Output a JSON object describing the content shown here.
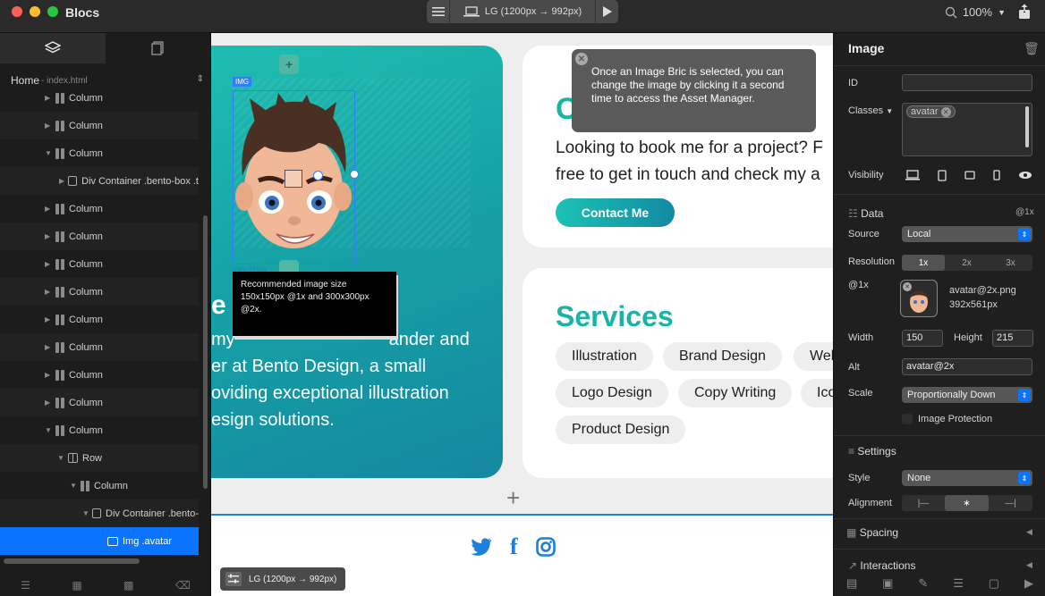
{
  "app": {
    "title": "Blocs",
    "zoom": "100%",
    "breakpoint": "LG (1200px → 992px)"
  },
  "left_panel": {
    "page": "Home",
    "page_file": "- index.html",
    "tree": [
      {
        "label": "Column",
        "type": "column",
        "indent": 50,
        "arrow": "right"
      },
      {
        "label": "Column",
        "type": "column",
        "indent": 50,
        "arrow": "right"
      },
      {
        "label": "Column",
        "type": "column",
        "indent": 50,
        "arrow": "down"
      },
      {
        "label": "Div Container .bento-box .t",
        "type": "box",
        "indent": 66,
        "arrow": "right"
      },
      {
        "label": "Column",
        "type": "column",
        "indent": 50,
        "arrow": "right"
      },
      {
        "label": "Column",
        "type": "column",
        "indent": 50,
        "arrow": "right"
      },
      {
        "label": "Column",
        "type": "column",
        "indent": 50,
        "arrow": "right"
      },
      {
        "label": "Column",
        "type": "column",
        "indent": 50,
        "arrow": "right"
      },
      {
        "label": "Column",
        "type": "column",
        "indent": 50,
        "arrow": "right"
      },
      {
        "label": "Column",
        "type": "column",
        "indent": 50,
        "arrow": "right"
      },
      {
        "label": "Column",
        "type": "column",
        "indent": 50,
        "arrow": "right"
      },
      {
        "label": "Column",
        "type": "column",
        "indent": 50,
        "arrow": "right"
      },
      {
        "label": "Column",
        "type": "column",
        "indent": 50,
        "arrow": "down"
      },
      {
        "label": "Row",
        "type": "row",
        "indent": 64,
        "arrow": "down"
      },
      {
        "label": "Column",
        "type": "column",
        "indent": 78,
        "arrow": "down"
      },
      {
        "label": "Div Container .bento-",
        "type": "box",
        "indent": 92,
        "arrow": "down"
      },
      {
        "label": "Img .avatar",
        "type": "img",
        "indent": 108,
        "arrow": "",
        "selected": true
      }
    ]
  },
  "canvas": {
    "img_tag": "IMG",
    "img_dims": "150x215px",
    "img_tooltip": "Recommended image size 150x150px @1x and 300x300px @2x.",
    "hero_letter": "e",
    "hero_lines": [
      " my",
      "er at Bento Design, a small",
      "oviding exceptional illustration",
      "esign solutions."
    ],
    "hero_line1_end": "ander and",
    "card1_letter": "C",
    "card1_lines": [
      "Looking to book me for a project? F",
      "free to get in touch and check my a"
    ],
    "contact_button": "Contact Me",
    "tip": "Once an Image Bric is selected, you can change the image by clicking it a second time to access the Asset Manager.",
    "services_title": "Services",
    "services": [
      "Illustration",
      "Brand Design",
      "Web",
      "Logo Design",
      "Copy Writing",
      "Ico",
      "Product Design"
    ],
    "social_icons": [
      "twitter-icon",
      "facebook-icon",
      "instagram-icon"
    ]
  },
  "right_panel": {
    "title": "Image",
    "id_label": "ID",
    "id_value": "",
    "classes_label": "Classes",
    "class_tag": "avatar",
    "visibility_label": "Visibility",
    "data_section": "Data",
    "data_density": "@1x",
    "source_label": "Source",
    "source_value": "Local",
    "resolution_label": "Resolution",
    "resolutions": [
      "1x",
      "2x",
      "3x"
    ],
    "at1x_label": "@1x",
    "file_name": "avatar@2x.png",
    "file_dims": "392x561px",
    "width_label": "Width",
    "width_value": "150",
    "height_label": "Height",
    "height_value": "215",
    "alt_label": "Alt",
    "alt_value": "avatar@2x",
    "scale_label": "Scale",
    "scale_value": "Proportionally Down",
    "image_protection": "Image Protection",
    "settings_section": "Settings",
    "style_label": "Style",
    "style_value": "None",
    "alignment_label": "Alignment",
    "spacing_section": "Spacing",
    "interactions_section": "Interactions"
  },
  "colors": {
    "accent": "#0a74ff",
    "teal": "#1ab3a6",
    "blue": "#1f7fdc"
  }
}
